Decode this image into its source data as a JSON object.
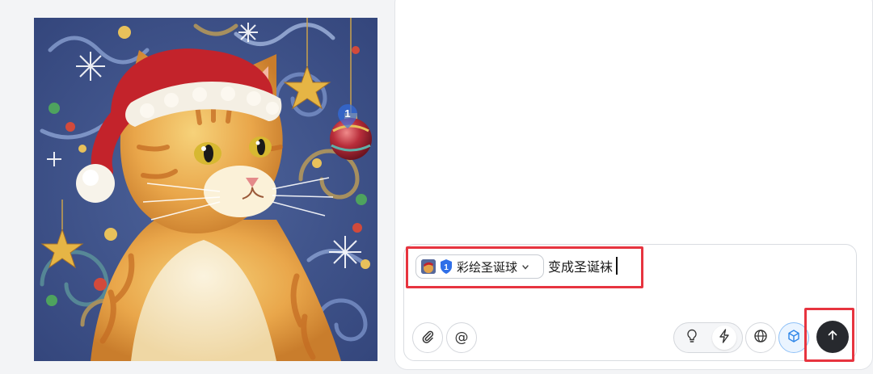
{
  "image": {
    "description_icon": "cat-santa-hat-painting",
    "marker_number": "1"
  },
  "composer": {
    "reference_chip": {
      "badge_number": "1",
      "label": "彩绘圣诞球",
      "chevron_icon": "chevron-down-icon"
    },
    "prompt_text": "变成圣诞袜",
    "toolbar": {
      "attach_icon": "paperclip-icon",
      "mention_symbol": "@",
      "mode_icons": [
        "lightbulb-icon",
        "lightning-icon"
      ],
      "web_icon": "globe-icon",
      "cube_icon": "cube-icon",
      "send_icon": "arrow-up-icon"
    }
  },
  "colors": {
    "highlight": "#e7343f",
    "send_button": "#27292e",
    "badge_blue": "#2f6fe8"
  }
}
